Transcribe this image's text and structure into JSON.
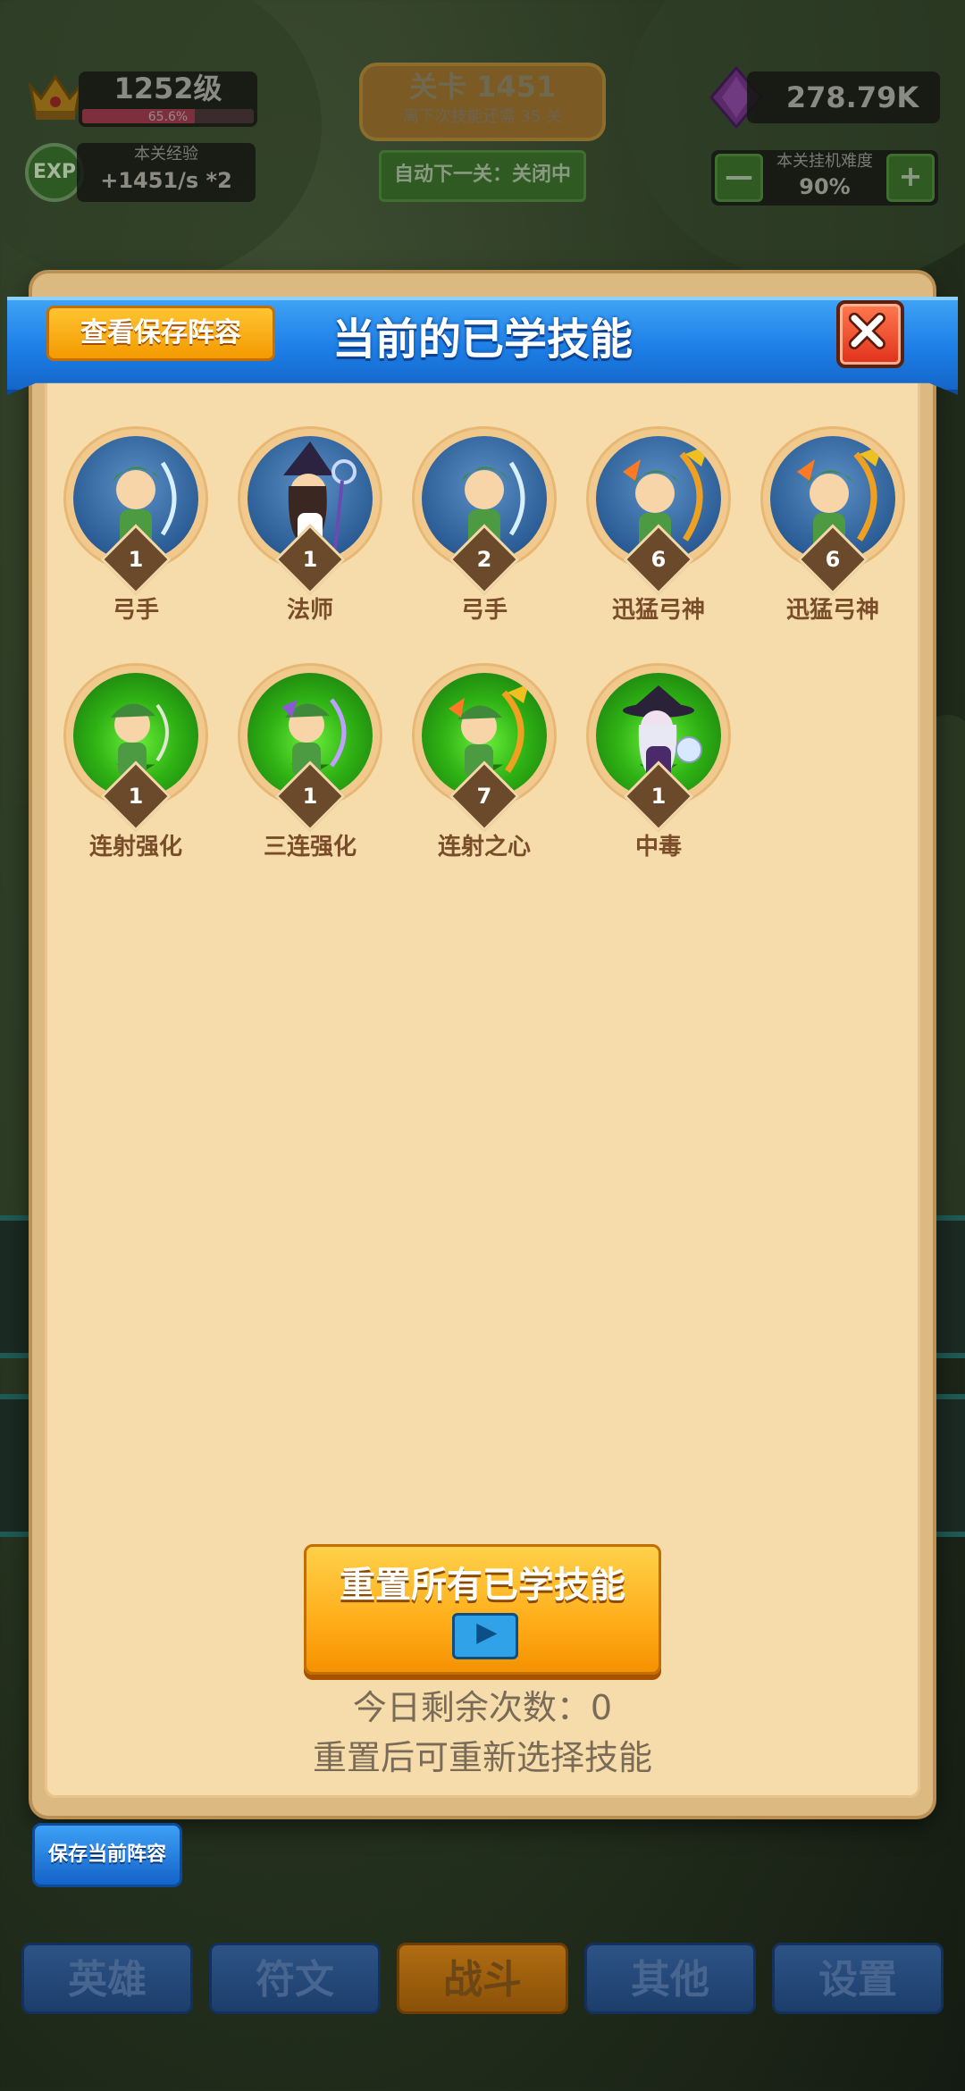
{
  "hud": {
    "level": "1252级",
    "level_progress_label": "65.6%",
    "level_progress": 0.656,
    "exp_icon": "EXP",
    "exp_title": "本关经验",
    "exp_value": "+1451/s *2",
    "stage_title": "关卡 1451",
    "stage_subtitle": "离下次技能还需 35 关",
    "auto_next": "自动下一关：关闭中",
    "gems": "278.79K",
    "difficulty_title": "本关挂机难度",
    "difficulty_value": "90%",
    "difficulty_minus": "—",
    "difficulty_plus": "+"
  },
  "modal": {
    "title": "当前的已学技能",
    "view_saved_label": "查看保存阵容",
    "close_icon": "close-icon",
    "skills": [
      {
        "name": "弓手",
        "level": "1",
        "bg": "blue"
      },
      {
        "name": "法师",
        "level": "1",
        "bg": "blue"
      },
      {
        "name": "弓手",
        "level": "2",
        "bg": "blue"
      },
      {
        "name": "迅猛弓神",
        "level": "6",
        "bg": "blue"
      },
      {
        "name": "迅猛弓神",
        "level": "6",
        "bg": "blue"
      },
      {
        "name": "连射强化",
        "level": "1",
        "bg": "green"
      },
      {
        "name": "三连强化",
        "level": "1",
        "bg": "green"
      },
      {
        "name": "连射之心",
        "level": "7",
        "bg": "green"
      },
      {
        "name": "中毒",
        "level": "1",
        "bg": "green"
      }
    ],
    "reset_label": "重置所有已学技能",
    "remaining_text": "今日剩余次数：0",
    "reset_hint": "重置后可重新选择技能"
  },
  "save_lineup_label": "保存当前阵容",
  "nav": {
    "items": [
      "英雄",
      "符文",
      "战斗",
      "其他",
      "设置"
    ],
    "active": "战斗"
  },
  "colors": {
    "banner_blue": "#1c7ee6",
    "button_orange": "#f5a000",
    "parchment": "#f6dcaa",
    "text_brown": "#7a4d2a"
  }
}
